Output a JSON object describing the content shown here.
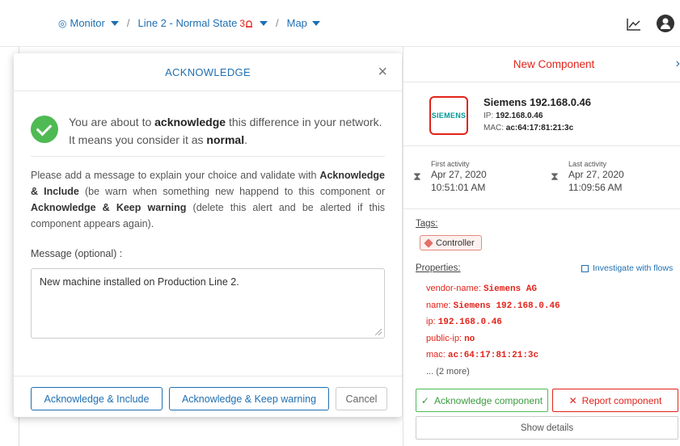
{
  "breadcrumb": {
    "monitor": "Monitor",
    "line": "Line 2 - Normal State",
    "alert_count": "3",
    "map": "Map"
  },
  "modal": {
    "title": "ACKNOWLEDGE",
    "close": "×",
    "confirm_part1": "You are about to ",
    "confirm_bold1": "acknowledge",
    "confirm_part2": " this difference in your network. It means you consider it as ",
    "confirm_bold2": "normal",
    "confirm_part3": ".",
    "instr_part1": "Please add a message to explain your choice and validate with ",
    "instr_bold1": "Acknowledge & Include",
    "instr_part2": " (be warn when something new happend to this component or ",
    "instr_bold2": "Acknowledge & Keep warning",
    "instr_part3": " (delete this alert and be alerted if this component appears again).",
    "message_label": "Message (optional) :",
    "message_value": "New machine installed on Production Line 2.",
    "btn_include": "Acknowledge & Include",
    "btn_keep": "Acknowledge & Keep warning",
    "btn_cancel": "Cancel"
  },
  "panel": {
    "title": "New Component",
    "next": "›",
    "logo_text": "SIEMENS",
    "name": "Siemens 192.168.0.46",
    "ip_label": "IP: ",
    "ip_value": "192.168.0.46",
    "mac_label": "MAC: ",
    "mac_value": "ac:64:17:81:21:3c",
    "first_activity_label": "First activity",
    "first_activity_date": "Apr 27, 2020",
    "first_activity_time": "10:51:01 AM",
    "last_activity_label": "Last activity",
    "last_activity_date": "Apr 27, 2020",
    "last_activity_time": "11:09:56 AM",
    "tags_label": "Tags:",
    "tag": "Controller",
    "properties_label": "Properties:",
    "investigate": "Investigate with flows",
    "properties": [
      {
        "k": "vendor-name: ",
        "v": "Siemens AG"
      },
      {
        "k": "name: ",
        "v": "Siemens 192.168.0.46"
      },
      {
        "k": "ip: ",
        "v": "192.168.0.46"
      },
      {
        "k": "public-ip: ",
        "v": "no"
      },
      {
        "k": "mac: ",
        "v": "ac:64:17:81:21:3c"
      }
    ],
    "more": "... (2 more)",
    "btn_ack": "Acknowledge component",
    "btn_report": "Report component",
    "btn_details": "Show details"
  }
}
